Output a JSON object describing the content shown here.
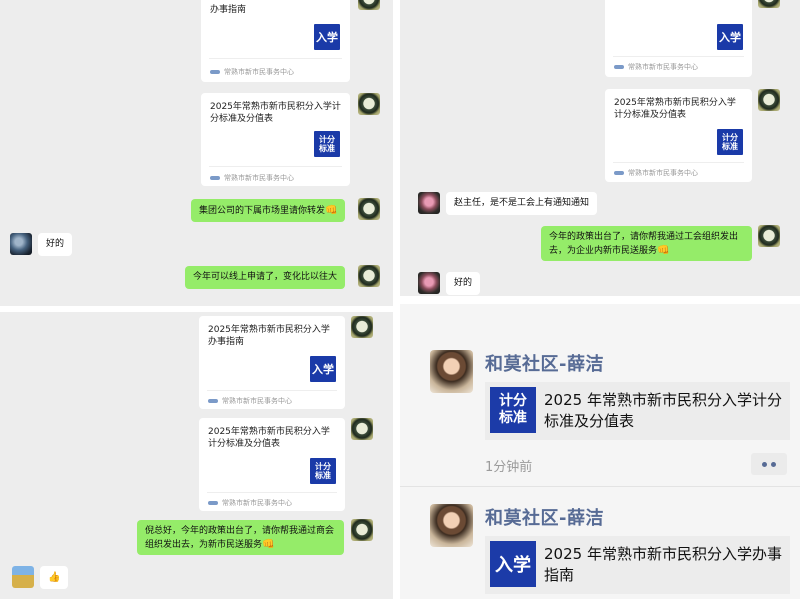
{
  "source_label": "常熟市新市民事务中心",
  "card_titles": {
    "guide": "2025年常熟市新市民积分入学办事指南",
    "guide_tail": "办事指南",
    "standard": "2025年常熟市新市民积分入学计分标准及分值表"
  },
  "thumb_labels": {
    "ruxue": "入学",
    "jifen": "计分",
    "biaozhun": "标准"
  },
  "chat_tl": {
    "msg_forward": "集团公司的下属市场里请你转发",
    "msg_ok": "好的",
    "msg_online": "今年可以线上申请了，变化比以往大"
  },
  "chat_tr": {
    "msg_question": "赵主任，是不是工会上有通知通知",
    "msg_policy": "今年的政策出台了，请你帮我通过工会组织发出去，为企业内新市民送服务",
    "msg_ok": "好的"
  },
  "chat_bl": {
    "msg_policy": "倪总好，今年的政策出台了，请你帮我通过商会组织发出去，为新市民送服务"
  },
  "emoji": {
    "fist": "👊",
    "thumb": "👍"
  },
  "moments": {
    "poster_name": "和莫社区-薛洁",
    "post1_title": "2025 年常熟市新市民积分入学计分标准及分值表",
    "post1_time": "1分钟前",
    "post2_title": "2025 年常熟市新市民积分入学办事指南"
  }
}
